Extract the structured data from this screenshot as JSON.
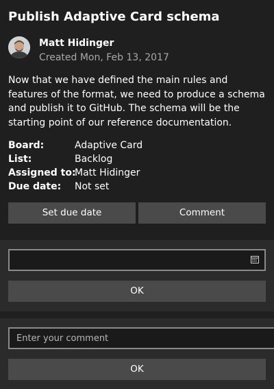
{
  "card": {
    "title": "Publish Adaptive Card schema",
    "author": "Matt Hidinger",
    "created": "Created Mon, Feb 13, 2017",
    "description": "Now that we have defined the main rules and features of the format, we need to produce a schema and publish it to GitHub. The schema will be the starting point of our reference documentation.",
    "facts": [
      {
        "title": "Board:",
        "value": "Adaptive Card"
      },
      {
        "title": "List:",
        "value": "Backlog"
      },
      {
        "title": "Assigned to:",
        "value": "Matt Hidinger"
      },
      {
        "title": "Due date:",
        "value": "Not set"
      }
    ],
    "actions": {
      "due_date_label": "Set due date",
      "comment_label": "Comment"
    }
  },
  "date_panel": {
    "value": "",
    "calendar_icon": "calendar-icon",
    "ok_label": "OK"
  },
  "comment_panel": {
    "placeholder": "Enter your comment",
    "value": "",
    "ok_label": "OK"
  },
  "colors": {
    "background": "#1f1f1f",
    "panel": "#2b2b2b",
    "button": "#4a4a4a",
    "input_border": "#8a8a8a",
    "subtle_text": "#a8a8a8"
  }
}
